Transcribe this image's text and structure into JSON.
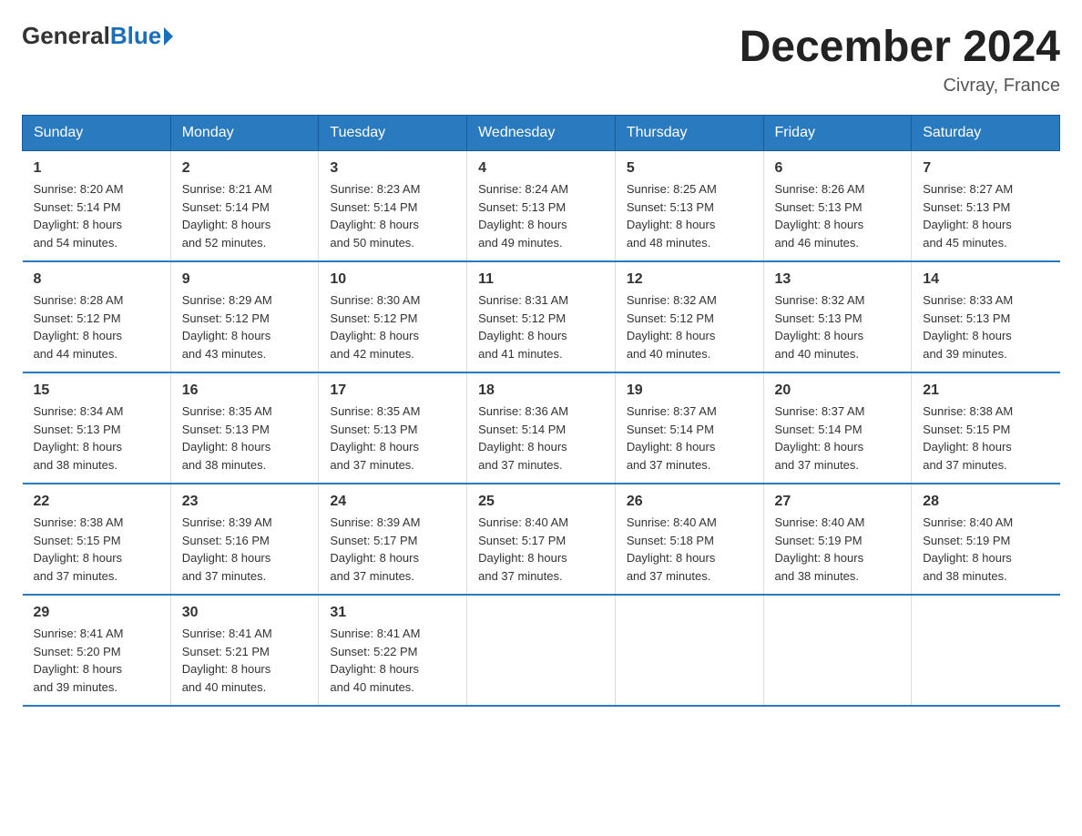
{
  "logo": {
    "general": "General",
    "blue": "Blue"
  },
  "title": "December 2024",
  "location": "Civray, France",
  "days_of_week": [
    "Sunday",
    "Monday",
    "Tuesday",
    "Wednesday",
    "Thursday",
    "Friday",
    "Saturday"
  ],
  "weeks": [
    [
      {
        "day": "1",
        "sunrise": "8:20 AM",
        "sunset": "5:14 PM",
        "daylight": "8 hours and 54 minutes."
      },
      {
        "day": "2",
        "sunrise": "8:21 AM",
        "sunset": "5:14 PM",
        "daylight": "8 hours and 52 minutes."
      },
      {
        "day": "3",
        "sunrise": "8:23 AM",
        "sunset": "5:14 PM",
        "daylight": "8 hours and 50 minutes."
      },
      {
        "day": "4",
        "sunrise": "8:24 AM",
        "sunset": "5:13 PM",
        "daylight": "8 hours and 49 minutes."
      },
      {
        "day": "5",
        "sunrise": "8:25 AM",
        "sunset": "5:13 PM",
        "daylight": "8 hours and 48 minutes."
      },
      {
        "day": "6",
        "sunrise": "8:26 AM",
        "sunset": "5:13 PM",
        "daylight": "8 hours and 46 minutes."
      },
      {
        "day": "7",
        "sunrise": "8:27 AM",
        "sunset": "5:13 PM",
        "daylight": "8 hours and 45 minutes."
      }
    ],
    [
      {
        "day": "8",
        "sunrise": "8:28 AM",
        "sunset": "5:12 PM",
        "daylight": "8 hours and 44 minutes."
      },
      {
        "day": "9",
        "sunrise": "8:29 AM",
        "sunset": "5:12 PM",
        "daylight": "8 hours and 43 minutes."
      },
      {
        "day": "10",
        "sunrise": "8:30 AM",
        "sunset": "5:12 PM",
        "daylight": "8 hours and 42 minutes."
      },
      {
        "day": "11",
        "sunrise": "8:31 AM",
        "sunset": "5:12 PM",
        "daylight": "8 hours and 41 minutes."
      },
      {
        "day": "12",
        "sunrise": "8:32 AM",
        "sunset": "5:12 PM",
        "daylight": "8 hours and 40 minutes."
      },
      {
        "day": "13",
        "sunrise": "8:32 AM",
        "sunset": "5:13 PM",
        "daylight": "8 hours and 40 minutes."
      },
      {
        "day": "14",
        "sunrise": "8:33 AM",
        "sunset": "5:13 PM",
        "daylight": "8 hours and 39 minutes."
      }
    ],
    [
      {
        "day": "15",
        "sunrise": "8:34 AM",
        "sunset": "5:13 PM",
        "daylight": "8 hours and 38 minutes."
      },
      {
        "day": "16",
        "sunrise": "8:35 AM",
        "sunset": "5:13 PM",
        "daylight": "8 hours and 38 minutes."
      },
      {
        "day": "17",
        "sunrise": "8:35 AM",
        "sunset": "5:13 PM",
        "daylight": "8 hours and 37 minutes."
      },
      {
        "day": "18",
        "sunrise": "8:36 AM",
        "sunset": "5:14 PM",
        "daylight": "8 hours and 37 minutes."
      },
      {
        "day": "19",
        "sunrise": "8:37 AM",
        "sunset": "5:14 PM",
        "daylight": "8 hours and 37 minutes."
      },
      {
        "day": "20",
        "sunrise": "8:37 AM",
        "sunset": "5:14 PM",
        "daylight": "8 hours and 37 minutes."
      },
      {
        "day": "21",
        "sunrise": "8:38 AM",
        "sunset": "5:15 PM",
        "daylight": "8 hours and 37 minutes."
      }
    ],
    [
      {
        "day": "22",
        "sunrise": "8:38 AM",
        "sunset": "5:15 PM",
        "daylight": "8 hours and 37 minutes."
      },
      {
        "day": "23",
        "sunrise": "8:39 AM",
        "sunset": "5:16 PM",
        "daylight": "8 hours and 37 minutes."
      },
      {
        "day": "24",
        "sunrise": "8:39 AM",
        "sunset": "5:17 PM",
        "daylight": "8 hours and 37 minutes."
      },
      {
        "day": "25",
        "sunrise": "8:40 AM",
        "sunset": "5:17 PM",
        "daylight": "8 hours and 37 minutes."
      },
      {
        "day": "26",
        "sunrise": "8:40 AM",
        "sunset": "5:18 PM",
        "daylight": "8 hours and 37 minutes."
      },
      {
        "day": "27",
        "sunrise": "8:40 AM",
        "sunset": "5:19 PM",
        "daylight": "8 hours and 38 minutes."
      },
      {
        "day": "28",
        "sunrise": "8:40 AM",
        "sunset": "5:19 PM",
        "daylight": "8 hours and 38 minutes."
      }
    ],
    [
      {
        "day": "29",
        "sunrise": "8:41 AM",
        "sunset": "5:20 PM",
        "daylight": "8 hours and 39 minutes."
      },
      {
        "day": "30",
        "sunrise": "8:41 AM",
        "sunset": "5:21 PM",
        "daylight": "8 hours and 40 minutes."
      },
      {
        "day": "31",
        "sunrise": "8:41 AM",
        "sunset": "5:22 PM",
        "daylight": "8 hours and 40 minutes."
      },
      null,
      null,
      null,
      null
    ]
  ],
  "labels": {
    "sunrise": "Sunrise:",
    "sunset": "Sunset:",
    "daylight": "Daylight:"
  }
}
